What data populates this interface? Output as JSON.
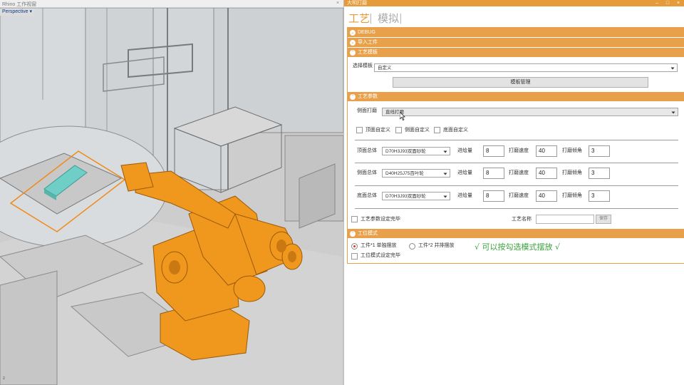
{
  "viewport": {
    "window_title": "Rhino 工作视窗",
    "view_label": "Perspective",
    "view_arrow": "▾",
    "window_close": "×",
    "axis_label": "z"
  },
  "panel": {
    "window_title": "大明打磨",
    "window_controls": {
      "minimize": "–",
      "maximize": "□",
      "close": "×"
    },
    "tabs": {
      "process": "工艺",
      "simulate": "模拟",
      "separator": "|"
    },
    "sections": {
      "debug": "DEBUG",
      "import_workpiece": "导入工件",
      "process_template": "工艺模板",
      "process_params": "工艺参数",
      "station_mode": "工位模式"
    },
    "template": {
      "select_label": "选择模板",
      "select_value": "自定义",
      "manage_button": "模板管理"
    },
    "params": {
      "side_grind_label": "侧面打磨",
      "side_grind_value": "直线打磨",
      "custom_checks": [
        {
          "label": "顶面自定义",
          "checked": false
        },
        {
          "label": "侧面自定义",
          "checked": false
        },
        {
          "label": "底面自定义",
          "checked": false
        }
      ],
      "feed_label": "进给量",
      "speed_label": "打磨速度",
      "angle_label": "打磨倾角",
      "rows": [
        {
          "label": "顶面总体",
          "tool": "D70H3J93双面砂轮",
          "feed": "8",
          "speed": "40",
          "angle": "3"
        },
        {
          "label": "侧面总体",
          "tool": "D40H25J75百叶轮",
          "feed": "8",
          "speed": "40",
          "angle": "3"
        },
        {
          "label": "底面总体",
          "tool": "D70H3J93双面砂轮",
          "feed": "8",
          "speed": "40",
          "angle": "3"
        }
      ],
      "params_done_label": "工艺参数设定完毕",
      "process_name_label": "工艺名称",
      "process_name_value": "",
      "save_button": "保存"
    },
    "station": {
      "radios": [
        {
          "label": "工件*1 单独摆放",
          "selected": true
        },
        {
          "label": "工件*2 并排摆放",
          "selected": false
        }
      ],
      "annotation": "√ 可以按勾选模式摆放 √",
      "mode_done_label": "工位模式设定完毕"
    }
  },
  "colors": {
    "accent": "#e8a14a",
    "robot": "#f0981e",
    "workpiece": "#6fcfc6",
    "annotation": "#3aa33a"
  }
}
